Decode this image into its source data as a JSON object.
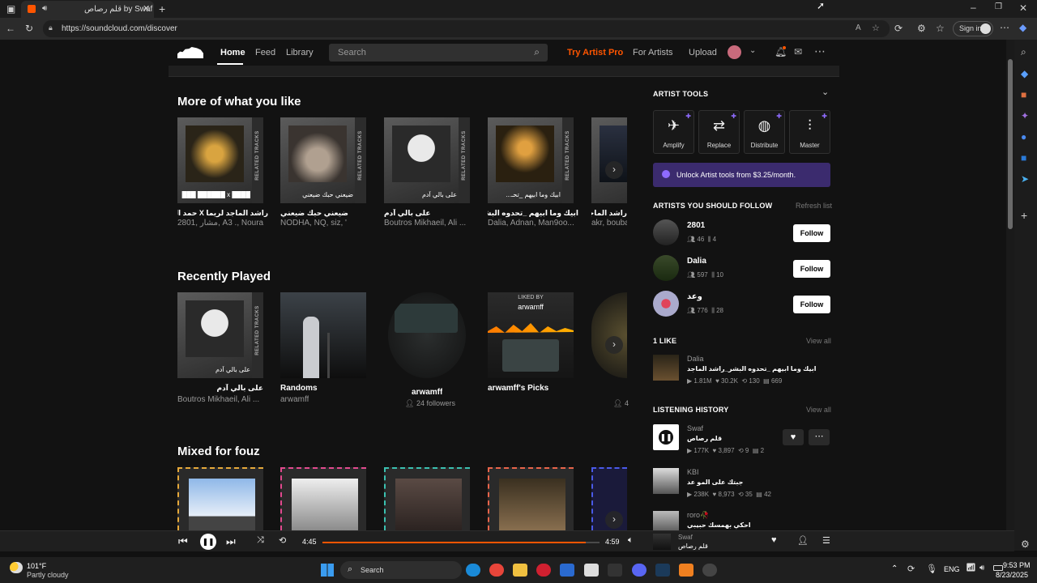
{
  "browser": {
    "tab_title": "قلم رصاص by Swaf",
    "url": "https://soundcloud.com/discover",
    "signin": "Sign in"
  },
  "header": {
    "nav": [
      "Home",
      "Feed",
      "Library"
    ],
    "search_placeholder": "Search",
    "try_pro": "Try Artist Pro",
    "for_artists": "For Artists",
    "upload": "Upload"
  },
  "sections": {
    "more_like": {
      "title": "More of what you like",
      "cards": [
        {
          "cap": "████ x ██████ ███",
          "title": "راشد الماجد لريما X حمد السعيد",
          "sub": "2801, مشار, A3 ., Noura"
        },
        {
          "cap": "ضيعني حبك ضيعني",
          "title": "ضيعني حبك ضيعني",
          "sub": "NODHA, NQ, siz, '"
        },
        {
          "cap": "على بالي آدم",
          "title": "على بالي آدم",
          "sub": "Boutros Mikhaeil, Ali ..."
        },
        {
          "cap": "ابيك وما ابيهم _تحـ...",
          "title": "ابيك وما ابيهم _تحدوه البشر_راشد الماجد",
          "sub": "Dalia, Adnan, Man9oo..."
        },
        {
          "cap": "راشد الماجد",
          "title": "راشد الماجد |",
          "sub": "akr, bouba"
        }
      ],
      "related": "RELATED TRACKS"
    },
    "recent": {
      "title": "Recently Played",
      "cards": [
        {
          "cap": "على بالي آدم",
          "title": "على بالي آدم",
          "sub": "Boutros Mikhaeil, Ali ..."
        },
        {
          "title": "Randoms",
          "sub": "arwamff"
        },
        {
          "title": "arwamff",
          "sub": "24 followers"
        },
        {
          "liked_by": "LIKED BY",
          "liked_user": "arwamff",
          "title": "arwamff's Picks"
        },
        {
          "sub": "4"
        }
      ]
    },
    "mixed": {
      "title": "Mixed for fouz"
    }
  },
  "panel": {
    "artist_tools": "ARTIST TOOLS",
    "tools": [
      "Amplify",
      "Replace",
      "Distribute",
      "Master"
    ],
    "unlock": "Unlock Artist tools from $3.25/month.",
    "follow_title": "ARTISTS YOU SHOULD FOLLOW",
    "refresh": "Refresh list",
    "artists": [
      {
        "name": "2801",
        "followers": "46",
        "tracks": "4",
        "btn": "Follow"
      },
      {
        "name": "Dalia",
        "followers": "597",
        "tracks": "10",
        "btn": "Follow"
      },
      {
        "name": "وعد",
        "followers": "776",
        "tracks": "28",
        "btn": "Follow"
      }
    ],
    "likes_title": "1 LIKE",
    "view_all": "View all",
    "like": {
      "user": "Dalia",
      "title": "ابيك وما ابيهم _تحدوه البشر_راشد الماجد",
      "plays": "1.81M",
      "likes": "30.2K",
      "reposts": "130",
      "comments": "669"
    },
    "history_title": "LISTENING HISTORY",
    "history": [
      {
        "user": "Swaf",
        "title": "قلم رصاص",
        "plays": "177K",
        "likes": "3,897",
        "reposts": "9",
        "comments": "2"
      },
      {
        "user": "KBI",
        "title": "جبتك على المو عد",
        "plays": "238K",
        "likes": "8,973",
        "reposts": "35",
        "comments": "42"
      },
      {
        "user": "roro🥀",
        "title": "احكي بهمسك حبيبي"
      }
    ]
  },
  "player": {
    "elapsed": "4:45",
    "total": "4:59",
    "progress": 0.95,
    "user": "Swaf",
    "title": "قلم رصاص"
  },
  "taskbar": {
    "temp": "101°F",
    "weather": "Partly cloudy",
    "search": "Search",
    "lang": "ENG",
    "time": "9:53 PM",
    "date": "8/23/2025"
  }
}
